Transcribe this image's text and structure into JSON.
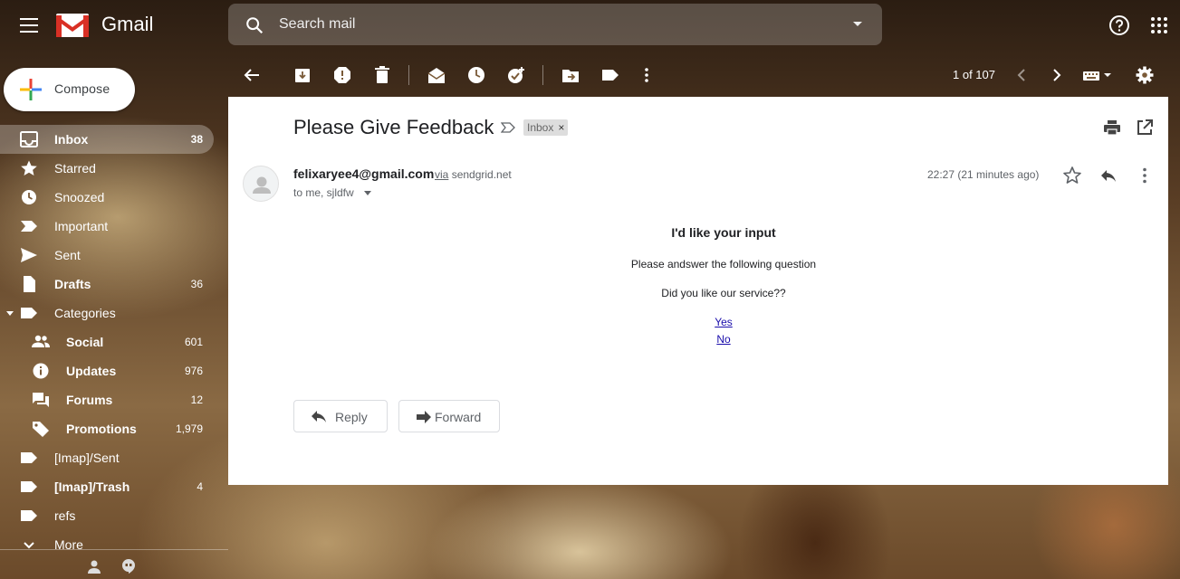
{
  "app": {
    "brand": "Gmail"
  },
  "search": {
    "placeholder": "Search mail"
  },
  "compose": {
    "label": "Compose"
  },
  "sidebar": {
    "items": [
      {
        "label": "Inbox",
        "count": "38",
        "icon": "inbox-icon",
        "bold": true,
        "active": true
      },
      {
        "label": "Starred",
        "count": "",
        "icon": "star-icon"
      },
      {
        "label": "Snoozed",
        "count": "",
        "icon": "clock-icon"
      },
      {
        "label": "Important",
        "count": "",
        "icon": "important-icon"
      },
      {
        "label": "Sent",
        "count": "",
        "icon": "send-icon"
      },
      {
        "label": "Drafts",
        "count": "36",
        "icon": "draft-icon",
        "bold": true
      },
      {
        "label": "Categories",
        "count": "",
        "icon": "label-icon"
      },
      {
        "label": "Social",
        "count": "601",
        "icon": "people-icon",
        "bold": true,
        "sub": true
      },
      {
        "label": "Updates",
        "count": "976",
        "icon": "info-icon",
        "bold": true,
        "sub": true
      },
      {
        "label": "Forums",
        "count": "12",
        "icon": "forum-icon",
        "bold": true,
        "sub": true
      },
      {
        "label": "Promotions",
        "count": "1,979",
        "icon": "tag-icon",
        "bold": true,
        "sub": true
      },
      {
        "label": "[Imap]/Sent",
        "count": "",
        "icon": "label-icon"
      },
      {
        "label": "[Imap]/Trash",
        "count": "4",
        "icon": "label-icon",
        "bold": true
      },
      {
        "label": "refs",
        "count": "",
        "icon": "label-icon"
      },
      {
        "label": "More",
        "count": "",
        "icon": "chevron-down-icon"
      }
    ]
  },
  "toolbar": {
    "pager": "1 of 107"
  },
  "message": {
    "subject": "Please Give Feedback",
    "label_chip": "Inbox",
    "label_chip_close": "×",
    "sender": "felixaryee4@gmail.com",
    "via_word": "via",
    "via_domain": "sendgrid.net",
    "to": "to me, sjldfw",
    "time": "22:27 (21 minutes ago)",
    "body": {
      "heading": "I'd like your input",
      "line1": "Please andswer the following question",
      "line2": "Did you like our service??",
      "link_yes": "Yes",
      "link_no": "No"
    },
    "reply_label": "Reply",
    "forward_label": "Forward"
  }
}
